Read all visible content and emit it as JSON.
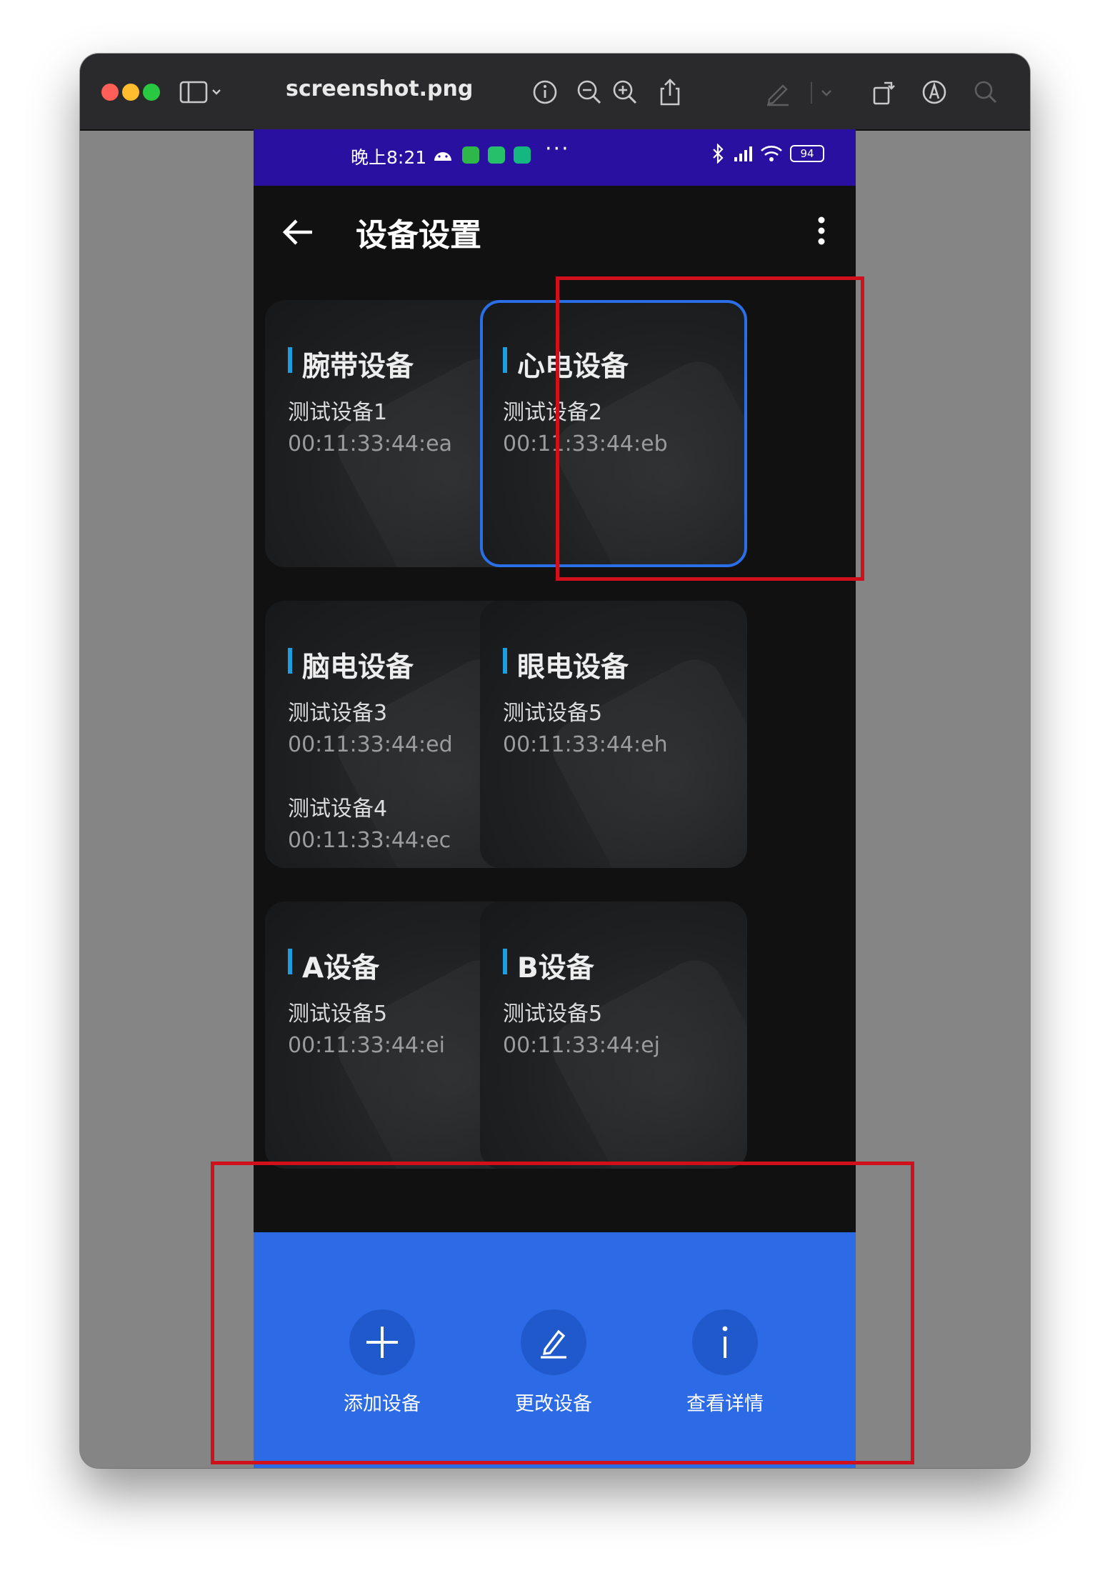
{
  "window": {
    "title": "screenshot.png",
    "traffic_lights": [
      "#ff5f57",
      "#febc2e",
      "#28c840"
    ]
  },
  "statusbar": {
    "time": "晚上8:21",
    "more": "···",
    "battery": "94"
  },
  "appbar": {
    "title": "设备设置"
  },
  "cards": [
    {
      "title": "腕带设备",
      "devices": [
        {
          "name": "测试设备1",
          "mac": "00:11:33:44:ea"
        }
      ],
      "selected": false
    },
    {
      "title": "心电设备",
      "devices": [
        {
          "name": "测试设备2",
          "mac": "00:11:33:44:eb"
        }
      ],
      "selected": true
    },
    {
      "title": "脑电设备",
      "devices": [
        {
          "name": "测试设备3",
          "mac": "00:11:33:44:ed"
        },
        {
          "name": "测试设备4",
          "mac": "00:11:33:44:ec"
        }
      ],
      "selected": false
    },
    {
      "title": "眼电设备",
      "devices": [
        {
          "name": "测试设备5",
          "mac": "00:11:33:44:eh"
        }
      ],
      "selected": false
    },
    {
      "title": "A设备",
      "devices": [
        {
          "name": "测试设备5",
          "mac": "00:11:33:44:ei"
        }
      ],
      "selected": false
    },
    {
      "title": "B设备",
      "devices": [
        {
          "name": "测试设备5",
          "mac": "00:11:33:44:ej"
        }
      ],
      "selected": false
    }
  ],
  "actions": [
    {
      "label": "添加设备",
      "icon": "plus-icon"
    },
    {
      "label": "更改设备",
      "icon": "edit-icon"
    },
    {
      "label": "查看详情",
      "icon": "info-icon"
    }
  ],
  "colors": {
    "statusbar": "#2a10a0",
    "accent_bar": "#1e9de0",
    "selected_border": "#2b6fe8",
    "bottom_panel": "#2c6ae6",
    "annotation": "#d0101a"
  }
}
